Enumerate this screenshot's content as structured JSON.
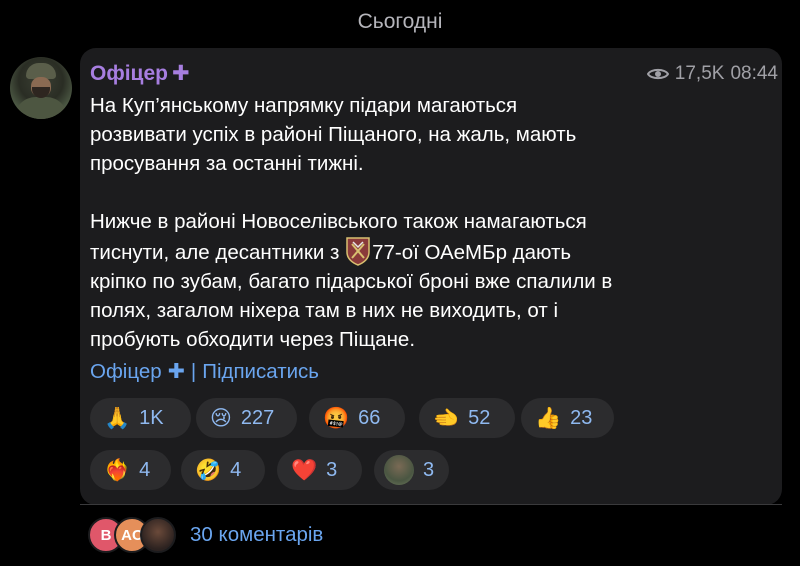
{
  "date_separator": "Сьогодні",
  "post": {
    "author": "Офіцер",
    "verified_mark": "✚",
    "views": "17,5K",
    "time": "08:44",
    "text_lines_1": [
      "На Куп’янському напрямку підари магаються",
      "розвивати успіх в районі Піщаного, на жаль, мають",
      "просування за останні тижні."
    ],
    "text_line_4": "Нижче в районі Новоселівського також намагаються",
    "text_line_5_before": "тиснути, але десантники з ",
    "text_line_5_after": "77-ої ОАеМБр дають",
    "text_lines_2": [
      "кріпко по зубам, багато підарської броні вже спалили в",
      "полях, загалом ніхера там в них не виходить, от і",
      "пробують обходити через Піщане."
    ],
    "signature_name": "Офіцер",
    "signature_cross": "✚",
    "signature_sep": "|",
    "signature_action": "Підписатись"
  },
  "reactions": [
    {
      "emoji": "🙏",
      "count": "1K"
    },
    {
      "emoji": "😢",
      "count": "227"
    },
    {
      "emoji": "🤬",
      "count": "66"
    },
    {
      "emoji": "🫲",
      "count": "52"
    },
    {
      "emoji": "👍",
      "count": "23"
    },
    {
      "emoji": "❤️‍🔥",
      "count": "4"
    },
    {
      "emoji": "🤣",
      "count": "4"
    },
    {
      "emoji": "❤️",
      "count": "3"
    },
    {
      "emoji": "avatar",
      "count": "3"
    }
  ],
  "comments": {
    "avatars": [
      "B",
      "AC"
    ],
    "label": "30 коментарів"
  },
  "colors": {
    "background": "#000000",
    "bubble": "#1c1c1e",
    "author": "#a77ee0",
    "link": "#6aa5ef",
    "reaction_bg": "#2c2c2e",
    "reaction_text": "#8fb9f0"
  }
}
